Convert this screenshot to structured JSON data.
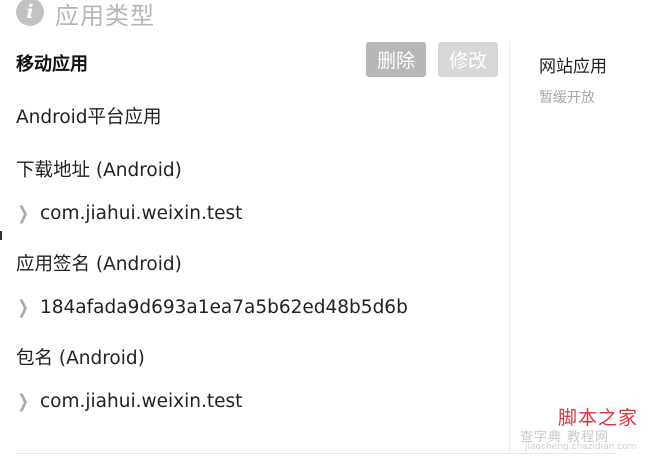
{
  "header": {
    "icon": "info-icon",
    "icon_glyph": "i",
    "title": "应用类型"
  },
  "mobile_app": {
    "title": "移动应用",
    "delete_label": "删除",
    "edit_label": "修改",
    "platform_label": "Android平台应用",
    "download_label": "下载地址 (Android)",
    "download_value": "com.jiahui.weixin.test",
    "signature_label": "应用签名 (Android)",
    "signature_value": "184afada9d693a1ea7a5b62ed48b5d6b",
    "package_label": "包名 (Android)",
    "package_value": "com.jiahui.weixin.test"
  },
  "web_app": {
    "title": "网站应用",
    "status": "暂缓开放"
  },
  "watermark": {
    "main": "脚本之家",
    "sub": "查字典 教程网",
    "url": "jiaocheng.chazidian.com"
  },
  "colors": {
    "button_delete": "#b8b8b8",
    "button_edit": "#d7d7d7",
    "watermark": "#e0313a"
  }
}
